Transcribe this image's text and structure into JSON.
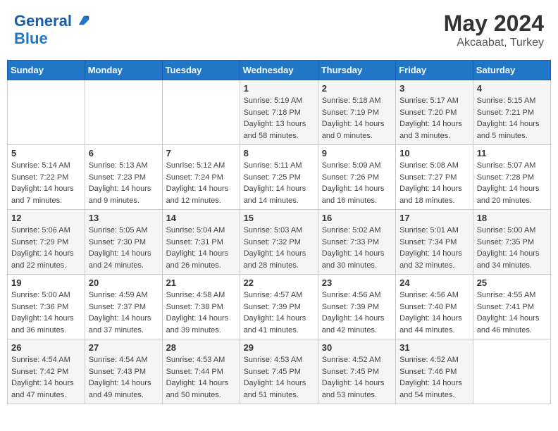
{
  "header": {
    "logo_line1": "General",
    "logo_line2": "Blue",
    "month": "May 2024",
    "location": "Akcaabat, Turkey"
  },
  "days_of_week": [
    "Sunday",
    "Monday",
    "Tuesday",
    "Wednesday",
    "Thursday",
    "Friday",
    "Saturday"
  ],
  "weeks": [
    [
      {
        "day": "",
        "info": ""
      },
      {
        "day": "",
        "info": ""
      },
      {
        "day": "",
        "info": ""
      },
      {
        "day": "1",
        "info": "Sunrise: 5:19 AM\nSunset: 7:18 PM\nDaylight: 13 hours and 58 minutes."
      },
      {
        "day": "2",
        "info": "Sunrise: 5:18 AM\nSunset: 7:19 PM\nDaylight: 14 hours and 0 minutes."
      },
      {
        "day": "3",
        "info": "Sunrise: 5:17 AM\nSunset: 7:20 PM\nDaylight: 14 hours and 3 minutes."
      },
      {
        "day": "4",
        "info": "Sunrise: 5:15 AM\nSunset: 7:21 PM\nDaylight: 14 hours and 5 minutes."
      }
    ],
    [
      {
        "day": "5",
        "info": "Sunrise: 5:14 AM\nSunset: 7:22 PM\nDaylight: 14 hours and 7 minutes."
      },
      {
        "day": "6",
        "info": "Sunrise: 5:13 AM\nSunset: 7:23 PM\nDaylight: 14 hours and 9 minutes."
      },
      {
        "day": "7",
        "info": "Sunrise: 5:12 AM\nSunset: 7:24 PM\nDaylight: 14 hours and 12 minutes."
      },
      {
        "day": "8",
        "info": "Sunrise: 5:11 AM\nSunset: 7:25 PM\nDaylight: 14 hours and 14 minutes."
      },
      {
        "day": "9",
        "info": "Sunrise: 5:09 AM\nSunset: 7:26 PM\nDaylight: 14 hours and 16 minutes."
      },
      {
        "day": "10",
        "info": "Sunrise: 5:08 AM\nSunset: 7:27 PM\nDaylight: 14 hours and 18 minutes."
      },
      {
        "day": "11",
        "info": "Sunrise: 5:07 AM\nSunset: 7:28 PM\nDaylight: 14 hours and 20 minutes."
      }
    ],
    [
      {
        "day": "12",
        "info": "Sunrise: 5:06 AM\nSunset: 7:29 PM\nDaylight: 14 hours and 22 minutes."
      },
      {
        "day": "13",
        "info": "Sunrise: 5:05 AM\nSunset: 7:30 PM\nDaylight: 14 hours and 24 minutes."
      },
      {
        "day": "14",
        "info": "Sunrise: 5:04 AM\nSunset: 7:31 PM\nDaylight: 14 hours and 26 minutes."
      },
      {
        "day": "15",
        "info": "Sunrise: 5:03 AM\nSunset: 7:32 PM\nDaylight: 14 hours and 28 minutes."
      },
      {
        "day": "16",
        "info": "Sunrise: 5:02 AM\nSunset: 7:33 PM\nDaylight: 14 hours and 30 minutes."
      },
      {
        "day": "17",
        "info": "Sunrise: 5:01 AM\nSunset: 7:34 PM\nDaylight: 14 hours and 32 minutes."
      },
      {
        "day": "18",
        "info": "Sunrise: 5:00 AM\nSunset: 7:35 PM\nDaylight: 14 hours and 34 minutes."
      }
    ],
    [
      {
        "day": "19",
        "info": "Sunrise: 5:00 AM\nSunset: 7:36 PM\nDaylight: 14 hours and 36 minutes."
      },
      {
        "day": "20",
        "info": "Sunrise: 4:59 AM\nSunset: 7:37 PM\nDaylight: 14 hours and 37 minutes."
      },
      {
        "day": "21",
        "info": "Sunrise: 4:58 AM\nSunset: 7:38 PM\nDaylight: 14 hours and 39 minutes."
      },
      {
        "day": "22",
        "info": "Sunrise: 4:57 AM\nSunset: 7:39 PM\nDaylight: 14 hours and 41 minutes."
      },
      {
        "day": "23",
        "info": "Sunrise: 4:56 AM\nSunset: 7:39 PM\nDaylight: 14 hours and 42 minutes."
      },
      {
        "day": "24",
        "info": "Sunrise: 4:56 AM\nSunset: 7:40 PM\nDaylight: 14 hours and 44 minutes."
      },
      {
        "day": "25",
        "info": "Sunrise: 4:55 AM\nSunset: 7:41 PM\nDaylight: 14 hours and 46 minutes."
      }
    ],
    [
      {
        "day": "26",
        "info": "Sunrise: 4:54 AM\nSunset: 7:42 PM\nDaylight: 14 hours and 47 minutes."
      },
      {
        "day": "27",
        "info": "Sunrise: 4:54 AM\nSunset: 7:43 PM\nDaylight: 14 hours and 49 minutes."
      },
      {
        "day": "28",
        "info": "Sunrise: 4:53 AM\nSunset: 7:44 PM\nDaylight: 14 hours and 50 minutes."
      },
      {
        "day": "29",
        "info": "Sunrise: 4:53 AM\nSunset: 7:45 PM\nDaylight: 14 hours and 51 minutes."
      },
      {
        "day": "30",
        "info": "Sunrise: 4:52 AM\nSunset: 7:45 PM\nDaylight: 14 hours and 53 minutes."
      },
      {
        "day": "31",
        "info": "Sunrise: 4:52 AM\nSunset: 7:46 PM\nDaylight: 14 hours and 54 minutes."
      },
      {
        "day": "",
        "info": ""
      }
    ]
  ]
}
